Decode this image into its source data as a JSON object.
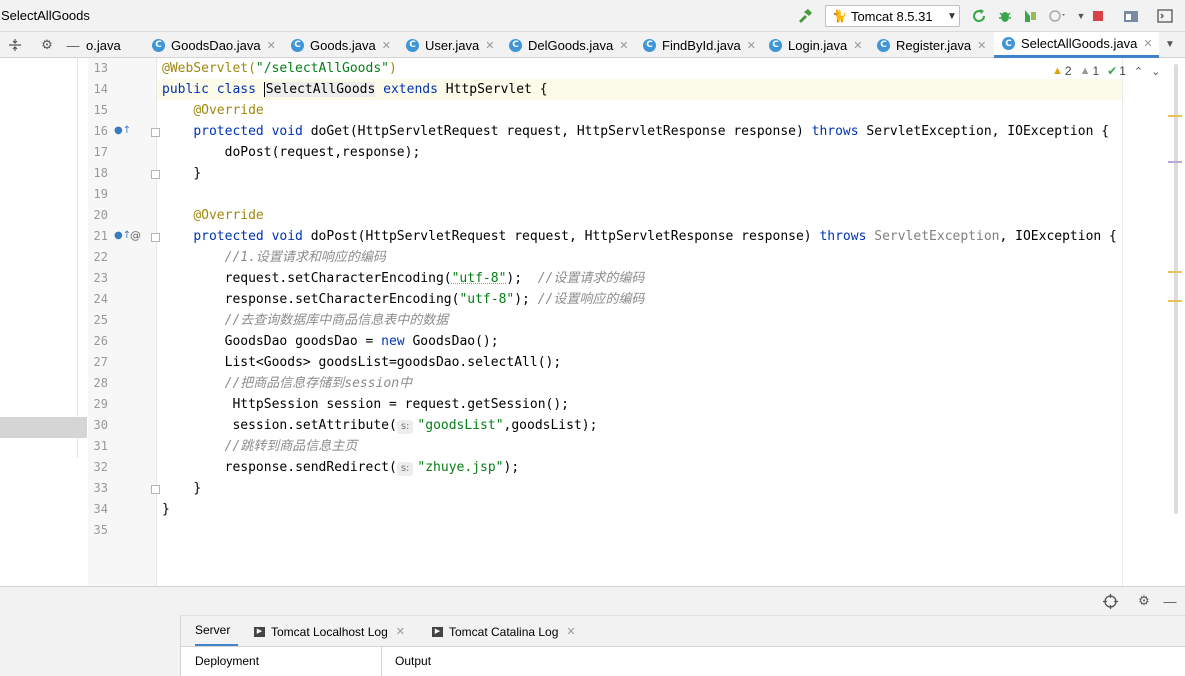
{
  "window": {
    "title": "SelectAllGoods"
  },
  "toolbar": {
    "run_config": "Tomcat 8.5.31",
    "icons": [
      "build-hammer-icon",
      "tomcat-icon",
      "rerun-icon",
      "debug-icon",
      "coverage-icon",
      "profile-icon",
      "stop-icon",
      "project-structure-icon",
      "terminal-icon"
    ]
  },
  "tabs": [
    {
      "label": "o.java",
      "active": false,
      "icon": ""
    },
    {
      "label": "GoodsDao.java",
      "active": false,
      "icon": "C"
    },
    {
      "label": "Goods.java",
      "active": false,
      "icon": "C"
    },
    {
      "label": "User.java",
      "active": false,
      "icon": "C"
    },
    {
      "label": "DelGoods.java",
      "active": false,
      "icon": "C"
    },
    {
      "label": "FindById.java",
      "active": false,
      "icon": "C"
    },
    {
      "label": "Login.java",
      "active": false,
      "icon": "C"
    },
    {
      "label": "Register.java",
      "active": false,
      "icon": "C"
    },
    {
      "label": "SelectAllGoods.java",
      "active": true,
      "icon": "C"
    }
  ],
  "inspections": {
    "warnings": "2",
    "weak_warnings": "1",
    "ok": "1"
  },
  "code": {
    "line_numbers": [
      "13",
      "14",
      "15",
      "16",
      "17",
      "18",
      "19",
      "20",
      "21",
      "22",
      "23",
      "24",
      "25",
      "26",
      "27",
      "28",
      "29",
      "30",
      "31",
      "32",
      "33",
      "34",
      "35"
    ],
    "l13_annotation": "@WebServlet(",
    "l13_string": "\"/selectAllGoods\"",
    "l13_end": ")",
    "l14_kw1": "public class ",
    "l14_name": "SelectAllGoods",
    "l14_kw2": " extends ",
    "l14_rest": "HttpServlet {",
    "override": "@Override",
    "l16_kw": "protected void ",
    "l16_rest": "doGet(HttpServletRequest request, HttpServletResponse response) ",
    "l16_throws": "throws",
    "l16_end": " ServletException, IOException {",
    "l17": "doPost(request,response);",
    "close": "}",
    "l21_kw": "protected void ",
    "l21_rest": "doPost(HttpServletRequest request, HttpServletResponse response) ",
    "l21_throws": "throws",
    "l21_gray": " ServletException",
    "l21_end": ", IOException {",
    "l22": "//1.设置请求和响应的编码",
    "l23_a": "request.setCharacterEncoding(",
    "l23_str": "\"utf-8\"",
    "l23_b": ");  ",
    "l23_cm": "//设置请求的编码",
    "l24_a": "response.setCharacterEncoding(",
    "l24_str": "\"utf-8\"",
    "l24_b": "); ",
    "l24_cm": "//设置响应的编码",
    "l25": "//去查询数据库中商品信息表中的数据",
    "l26_a": "GoodsDao goodsDao = ",
    "l26_kw": "new",
    "l26_b": " GoodsDao();",
    "l27": "List<Goods> goodsList=goodsDao.selectAll();",
    "l28": "//把商品信息存储到session中",
    "l29": "HttpSession session = request.getSession();",
    "l30_a": "session.setAttribute(",
    "param_hint": "s:",
    "l30_str": "\"goodsList\"",
    "l30_b": ",goodsList);",
    "l31": "//跳转到商品信息主页",
    "l32_a": "response.sendRedirect(",
    "l32_str": "\"zhuye.jsp\"",
    "l32_b": ");",
    "l34": "}"
  },
  "bottom": {
    "tabs": [
      {
        "label": "Server",
        "active": true
      },
      {
        "label": "Tomcat Localhost Log",
        "active": false
      },
      {
        "label": "Tomcat Catalina Log",
        "active": false
      }
    ],
    "columns": {
      "deployment": "Deployment",
      "output": "Output"
    }
  }
}
